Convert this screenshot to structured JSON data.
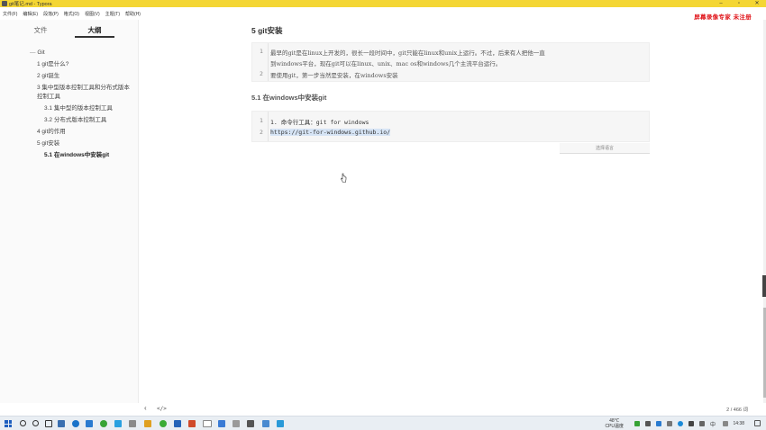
{
  "window": {
    "title": "git笔记.md - Typora"
  },
  "menu": [
    "文件(F)",
    "编辑(E)",
    "段落(P)",
    "格式(O)",
    "视图(V)",
    "主题(T)",
    "帮助(H)"
  ],
  "watermark": "屏幕录像专家 未注册",
  "sidebar": {
    "tabs": [
      {
        "label": "文件",
        "active": false
      },
      {
        "label": "大纲",
        "active": true
      }
    ],
    "outline": [
      {
        "label": "Git",
        "level": 1
      },
      {
        "label": "1 git是什么?",
        "level": 2
      },
      {
        "label": "2 git诞生",
        "level": 2
      },
      {
        "label": "3 集中型版本控制工具和分布式版本控制工具",
        "level": 2
      },
      {
        "label": "3.1 集中型的版本控制工具",
        "level": 3
      },
      {
        "label": "3.2 分布式版本控制工具",
        "level": 3
      },
      {
        "label": "4 git的作用",
        "level": 2
      },
      {
        "label": "5 git安装",
        "level": 2
      },
      {
        "label": "5.1 在windows中安装git",
        "level": 3,
        "active": true
      }
    ]
  },
  "editor": {
    "heading_5": "5 git安装",
    "block1": {
      "lines": [
        {
          "num": "1",
          "text": "    最早的git是在linux上开发的，很长一段时间中，git只能在linux和unix上运行。不过，后来有人把他一直"
        },
        {
          "num": "",
          "text": "到windows平台，现在git可以在linux、unix、mac os和windows几个主流平台运行。"
        },
        {
          "num": "2",
          "text": "    要使用git，第一步当然是安装，在windows安装"
        }
      ]
    },
    "heading_5_1": "5.1 在windows中安装git",
    "block2": {
      "lines": [
        {
          "num": "1",
          "text": "1. 命令行工具：git for windows"
        },
        {
          "num": "2",
          "text": "https://git-for-windows.github.io/"
        }
      ]
    },
    "lang_select": "选择语言"
  },
  "status": {
    "back": "‹",
    "source_toggle": "</>",
    "words": "2 / 466 词"
  },
  "taskbar": {
    "temp": "48℃",
    "temp_label": "CPU温度",
    "ime": "中",
    "time": "14:38"
  }
}
